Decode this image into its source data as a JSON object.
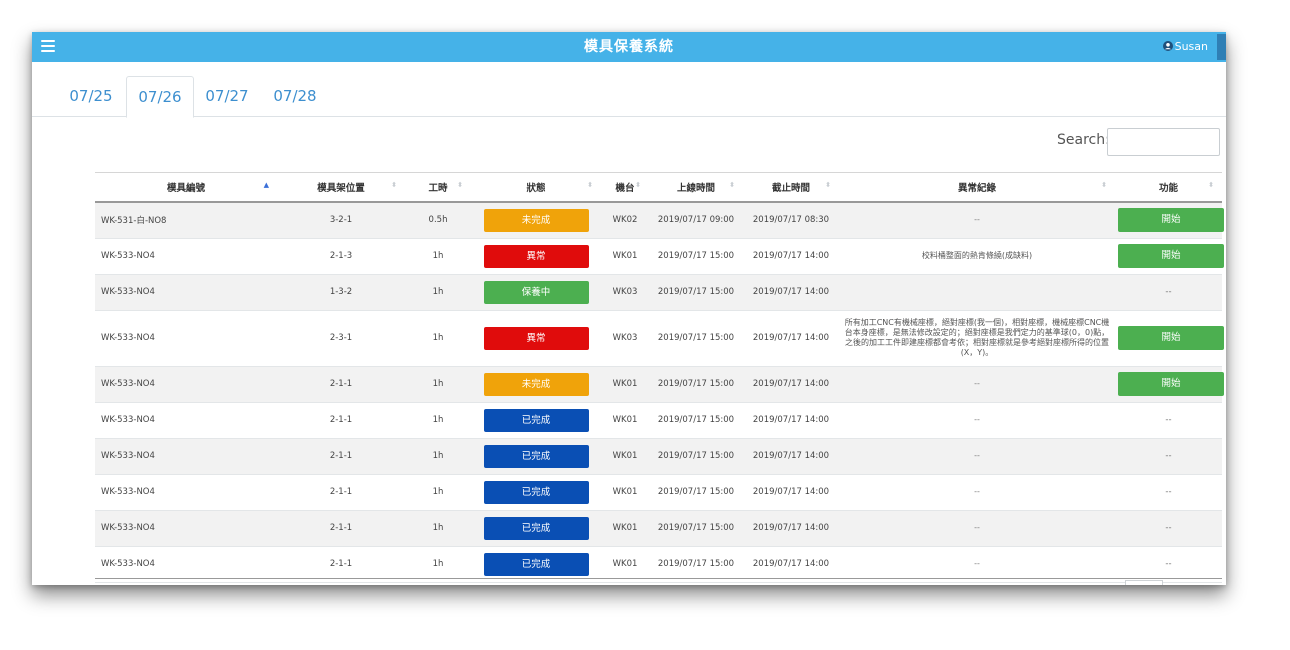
{
  "app": {
    "title": "模具保養系統",
    "user": "Susan"
  },
  "tabs": [
    "07/25",
    "07/26",
    "07/27",
    "07/28"
  ],
  "search": {
    "label": "Search:",
    "value": ""
  },
  "table": {
    "headers": [
      "模具編號",
      "模具架位置",
      "工時",
      "狀態",
      "機台",
      "上線時間",
      "截止時間",
      "異常紀錄",
      "功能"
    ],
    "rows": [
      {
        "code": "WK-531-白-NO8",
        "loc": "3-2-1",
        "hours": "0.5h",
        "status": "未完成",
        "machine": "WK02",
        "online": "2019/07/17 09:00",
        "deadline": "2019/07/17 08:30",
        "note": "--",
        "action": "開始"
      },
      {
        "code": "WK-533-NO4",
        "loc": "2-1-3",
        "hours": "1h",
        "status": "異常",
        "machine": "WK01",
        "online": "2019/07/17 15:00",
        "deadline": "2019/07/17 14:00",
        "note": "校料桶整面的熱肯條繞(成缺料)",
        "action": "開始"
      },
      {
        "code": "WK-533-NO4",
        "loc": "1-3-2",
        "hours": "1h",
        "status": "保養中",
        "machine": "WK03",
        "online": "2019/07/17 15:00",
        "deadline": "2019/07/17 14:00",
        "note": "",
        "action": "--"
      },
      {
        "code": "WK-533-NO4",
        "loc": "2-3-1",
        "hours": "1h",
        "status": "異常",
        "machine": "WK03",
        "online": "2019/07/17 15:00",
        "deadline": "2019/07/17 14:00",
        "note": "所有加工CNC有機械座標，絕對座標(我一個)，相對座標，機械座標CNC機台本身座標，是無法修改設定的；絕對座標是我們定力的基準球(0，0)點，之後的加工工件即建座標都會考依；相對座標就是參考絕對座標所得的位置(X，Y)。",
        "action": "開始"
      },
      {
        "code": "WK-533-NO4",
        "loc": "2-1-1",
        "hours": "1h",
        "status": "未完成",
        "machine": "WK01",
        "online": "2019/07/17 15:00",
        "deadline": "2019/07/17 14:00",
        "note": "--",
        "action": "開始"
      },
      {
        "code": "WK-533-NO4",
        "loc": "2-1-1",
        "hours": "1h",
        "status": "已完成",
        "machine": "WK01",
        "online": "2019/07/17 15:00",
        "deadline": "2019/07/17 14:00",
        "note": "--",
        "action": "--"
      },
      {
        "code": "WK-533-NO4",
        "loc": "2-1-1",
        "hours": "1h",
        "status": "已完成",
        "machine": "WK01",
        "online": "2019/07/17 15:00",
        "deadline": "2019/07/17 14:00",
        "note": "--",
        "action": "--"
      },
      {
        "code": "WK-533-NO4",
        "loc": "2-1-1",
        "hours": "1h",
        "status": "已完成",
        "machine": "WK01",
        "online": "2019/07/17 15:00",
        "deadline": "2019/07/17 14:00",
        "note": "--",
        "action": "--"
      },
      {
        "code": "WK-533-NO4",
        "loc": "2-1-1",
        "hours": "1h",
        "status": "已完成",
        "machine": "WK01",
        "online": "2019/07/17 15:00",
        "deadline": "2019/07/17 14:00",
        "note": "--",
        "action": "--"
      },
      {
        "code": "WK-533-NO4",
        "loc": "2-1-1",
        "hours": "1h",
        "status": "已完成",
        "machine": "WK01",
        "online": "2019/07/17 15:00",
        "deadline": "2019/07/17 14:00",
        "note": "--",
        "action": "--"
      }
    ]
  },
  "status_colors": {
    "未完成": "#f0a30a",
    "異常": "#e00c0c",
    "保養中": "#4caf50",
    "已完成": "#0a4fb4"
  }
}
